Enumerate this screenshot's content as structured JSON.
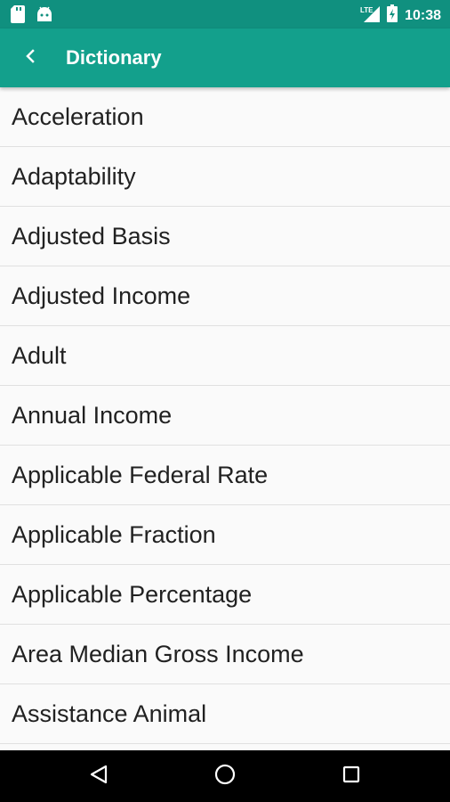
{
  "status_bar": {
    "time": "10:38",
    "icons": [
      "sd-card-icon",
      "android-icon",
      "signal-lte-icon",
      "battery-charging-icon"
    ]
  },
  "app_bar": {
    "title": "Dictionary",
    "back_icon": "back-arrow-icon"
  },
  "terms": [
    "Acceleration",
    "Adaptability",
    "Adjusted Basis",
    "Adjusted Income",
    "Adult",
    "Annual Income",
    "Applicable Federal Rate",
    "Applicable Fraction",
    "Applicable Percentage",
    "Area Median Gross Income",
    "Assistance Animal",
    ""
  ],
  "nav_bar": {
    "icons": [
      "back-triangle-icon",
      "home-circle-icon",
      "recents-square-icon"
    ]
  },
  "colors": {
    "status_bar": "#10907f",
    "app_bar": "#13a08c",
    "background": "#fafafa",
    "text": "#212121",
    "divider": "#e0e0e0"
  }
}
